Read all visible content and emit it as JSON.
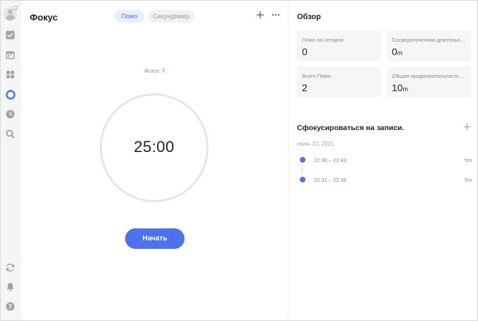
{
  "sidebar": {
    "items": [
      {
        "icon": "check-square-icon"
      },
      {
        "icon": "calendar-icon"
      },
      {
        "icon": "grid-icon"
      },
      {
        "icon": "pomodoro-icon",
        "active": true
      },
      {
        "icon": "clock-icon"
      },
      {
        "icon": "search-icon"
      },
      {
        "icon": "sync-icon"
      },
      {
        "icon": "bell-icon"
      },
      {
        "icon": "help-icon",
        "glyph": "?"
      }
    ],
    "accent": "#4d73ec"
  },
  "focus": {
    "title": "Фокус",
    "tabs": {
      "pomo": "Помо",
      "stopwatch": "Секундомер"
    },
    "focus_link": "Фокус",
    "time": "25:00",
    "start_label": "Начать"
  },
  "overview": {
    "title": "Обзор",
    "cards": [
      {
        "label": "Помо на сегодня",
        "value": "0",
        "unit": ""
      },
      {
        "label": "Сосредоточенная длительность",
        "value": "0",
        "unit": "m"
      },
      {
        "label": "Всего Помо",
        "value": "2",
        "unit": ""
      },
      {
        "label": "Общая продолжительность фокуса",
        "value": "10",
        "unit": "m"
      }
    ]
  },
  "records": {
    "title": "Сфокусироваться на записи.",
    "date": "июнь 23, 2021",
    "items": [
      {
        "time": "22:38 – 22:43",
        "duration": "5m"
      },
      {
        "time": "22:31 – 22:36",
        "duration": "5m"
      }
    ]
  }
}
